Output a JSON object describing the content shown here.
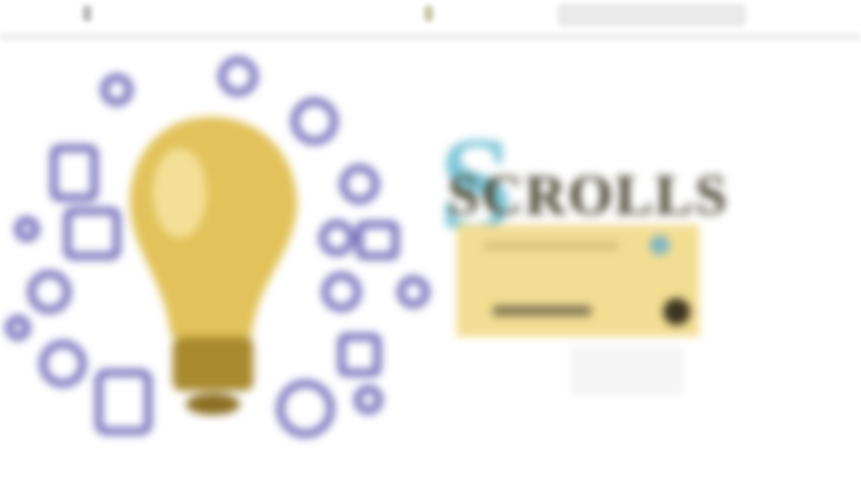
{
  "header": {
    "nav_icon_names": [
      "menu-icon",
      "home-icon",
      "search-bar"
    ]
  },
  "hero": {
    "logo_text": "SCROLLS",
    "illustration": "lightbulb-icon",
    "colors": {
      "bulb": "#d9b44a",
      "icons": "#6b63b5",
      "card": "#f3dd93",
      "accent": "#7fc6d8"
    }
  }
}
